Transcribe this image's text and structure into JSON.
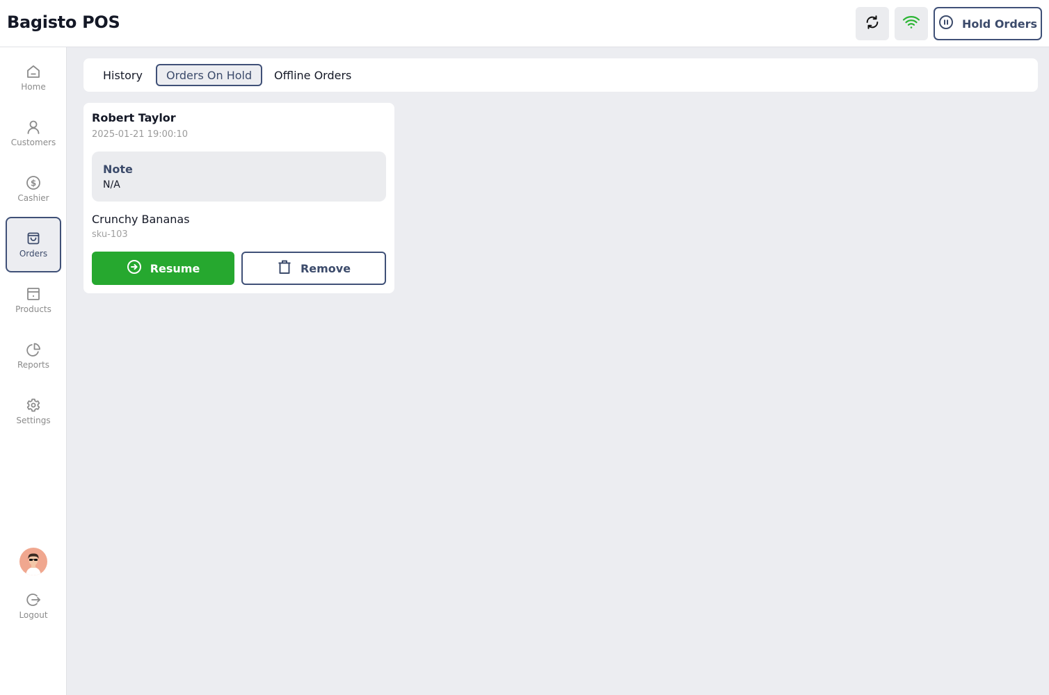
{
  "header": {
    "app_title": "Bagisto POS",
    "sync_icon": "sync-icon",
    "wifi_icon": "wifi-icon",
    "hold_orders_label": "Hold Orders",
    "hold_orders_icon": "pause-circle-icon"
  },
  "sidebar": {
    "items": [
      {
        "label": "Home",
        "icon": "home-icon",
        "active": false
      },
      {
        "label": "Customers",
        "icon": "user-icon",
        "active": false
      },
      {
        "label": "Cashier",
        "icon": "dollar-circle-icon",
        "active": false
      },
      {
        "label": "Orders",
        "icon": "shopping-bag-icon",
        "active": true
      },
      {
        "label": "Products",
        "icon": "box-icon",
        "active": false
      },
      {
        "label": "Reports",
        "icon": "pie-chart-icon",
        "active": false
      },
      {
        "label": "Settings",
        "icon": "gear-icon",
        "active": false
      }
    ],
    "logout_label": "Logout"
  },
  "tabs": [
    {
      "label": "History",
      "active": false
    },
    {
      "label": "Orders On Hold",
      "active": true
    },
    {
      "label": "Offline Orders",
      "active": false
    }
  ],
  "held_orders": [
    {
      "customer_name": "Robert Taylor",
      "timestamp": "2025-01-21 19:00:10",
      "note_label": "Note",
      "note_value": "N/A",
      "product_name": "Crunchy Bananas",
      "product_sku": "sku-103",
      "resume_label": "Resume",
      "remove_label": "Remove"
    }
  ],
  "colors": {
    "accent": "#3f5077",
    "success": "#26a82f",
    "background": "#ecedf1"
  }
}
